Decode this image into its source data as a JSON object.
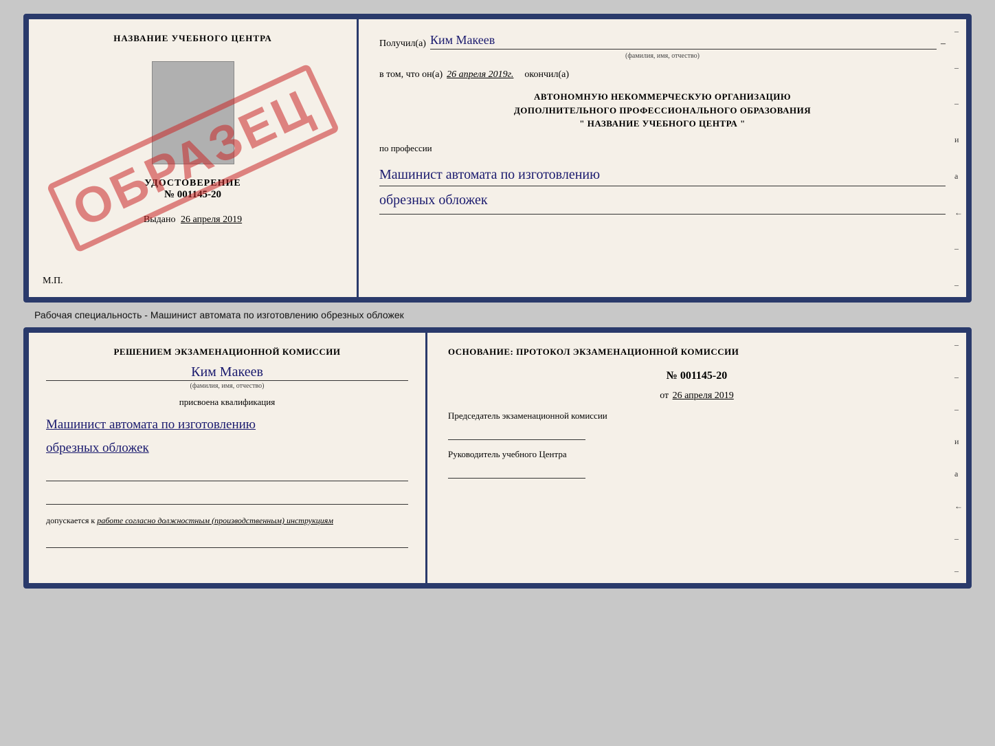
{
  "top_doc": {
    "left": {
      "school_name": "НАЗВАНИЕ УЧЕБНОГО ЦЕНТРА",
      "stamp": "ОБРАЗЕЦ",
      "udostoverenie_title": "УДОСТОВЕРЕНИЕ",
      "udostoverenie_num": "№ 001145-20",
      "vydano_label": "Выдано",
      "vydano_date": "26 апреля 2019",
      "mp": "М.П."
    },
    "right": {
      "poluchil_label": "Получил(а)",
      "poluchil_name": "Ким Макеев",
      "fio_sub": "(фамилия, имя, отчество)",
      "vtom_label": "в том, что он(а)",
      "vtom_date": "26 апреля 2019г.",
      "okonchil_label": "окончил(а)",
      "org_line1": "АВТОНОМНУЮ НЕКОММЕРЧЕСКУЮ ОРГАНИЗАЦИЮ",
      "org_line2": "ДОПОЛНИТЕЛЬНОГО ПРОФЕССИОНАЛЬНОГО ОБРАЗОВАНИЯ",
      "org_line3": "\"   НАЗВАНИЕ УЧЕБНОГО ЦЕНТРА   \"",
      "po_professii": "по профессии",
      "profession_line1": "Машинист автомата по изготовлению",
      "profession_line2": "обрезных обложек"
    }
  },
  "caption": "Рабочая специальность - Машинист автомата по изготовлению обрезных обложек",
  "bottom_doc": {
    "left": {
      "resheniem_title": "Решением экзаменационной комиссии",
      "kim_makeev": "Ким Макеев",
      "fio_sub": "(фамилия, имя, отчество)",
      "prisvoena": "присвоена квалификация",
      "profession_line1": "Машинист автомата по изготовлению",
      "profession_line2": "обрезных обложек",
      "dopuskaetsya_label": "допускается к",
      "dopuskaetsya_text": "работе согласно должностным (производственным) инструкциям"
    },
    "right": {
      "osnovanie_label": "Основание: протокол экзаменационной комиссии",
      "protocol_num": "№  001145-20",
      "ot_label": "от",
      "ot_date": "26 апреля 2019",
      "predsedatel_label": "Председатель экзаменационной комиссии",
      "rukovoditel_label": "Руководитель учебного Центра"
    }
  },
  "side_marks": {
    "top": [
      "и",
      "а",
      "←",
      "–",
      "–",
      "–",
      "–",
      "–"
    ],
    "bottom": [
      "и",
      "а",
      "←",
      "–",
      "–",
      "–",
      "–",
      "–"
    ]
  }
}
